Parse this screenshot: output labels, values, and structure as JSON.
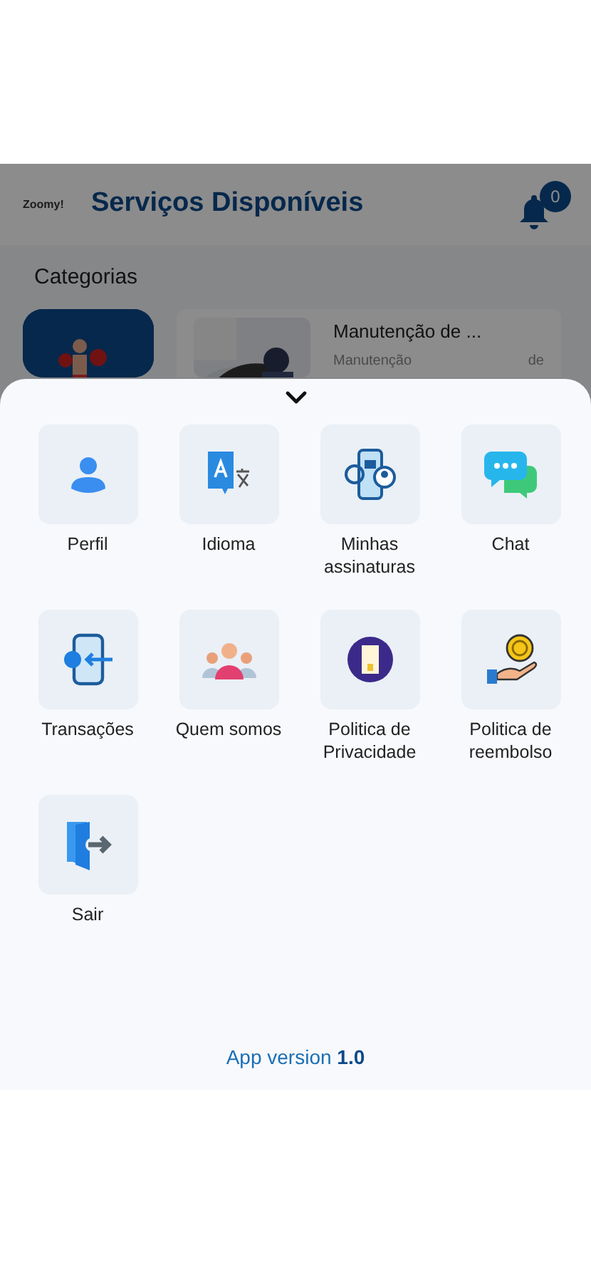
{
  "header": {
    "logo": "Zoomy!",
    "title": "Serviços Disponíveis",
    "notification_count": "0"
  },
  "categories": {
    "title": "Categorias",
    "services": [
      {
        "title": "Manutenção de ...",
        "subtitle_start": "Manutenção",
        "subtitle_end": "de"
      }
    ]
  },
  "menu": {
    "items": [
      {
        "label": "Perfil"
      },
      {
        "label": "Idioma"
      },
      {
        "label": "Minhas assinaturas"
      },
      {
        "label": "Chat"
      },
      {
        "label": "Transações"
      },
      {
        "label": "Quem somos"
      },
      {
        "label": "Politica de Privacidade"
      },
      {
        "label": "Politica de reembolso"
      },
      {
        "label": "Sair"
      }
    ],
    "version_label": "App version",
    "version": "1.0"
  }
}
